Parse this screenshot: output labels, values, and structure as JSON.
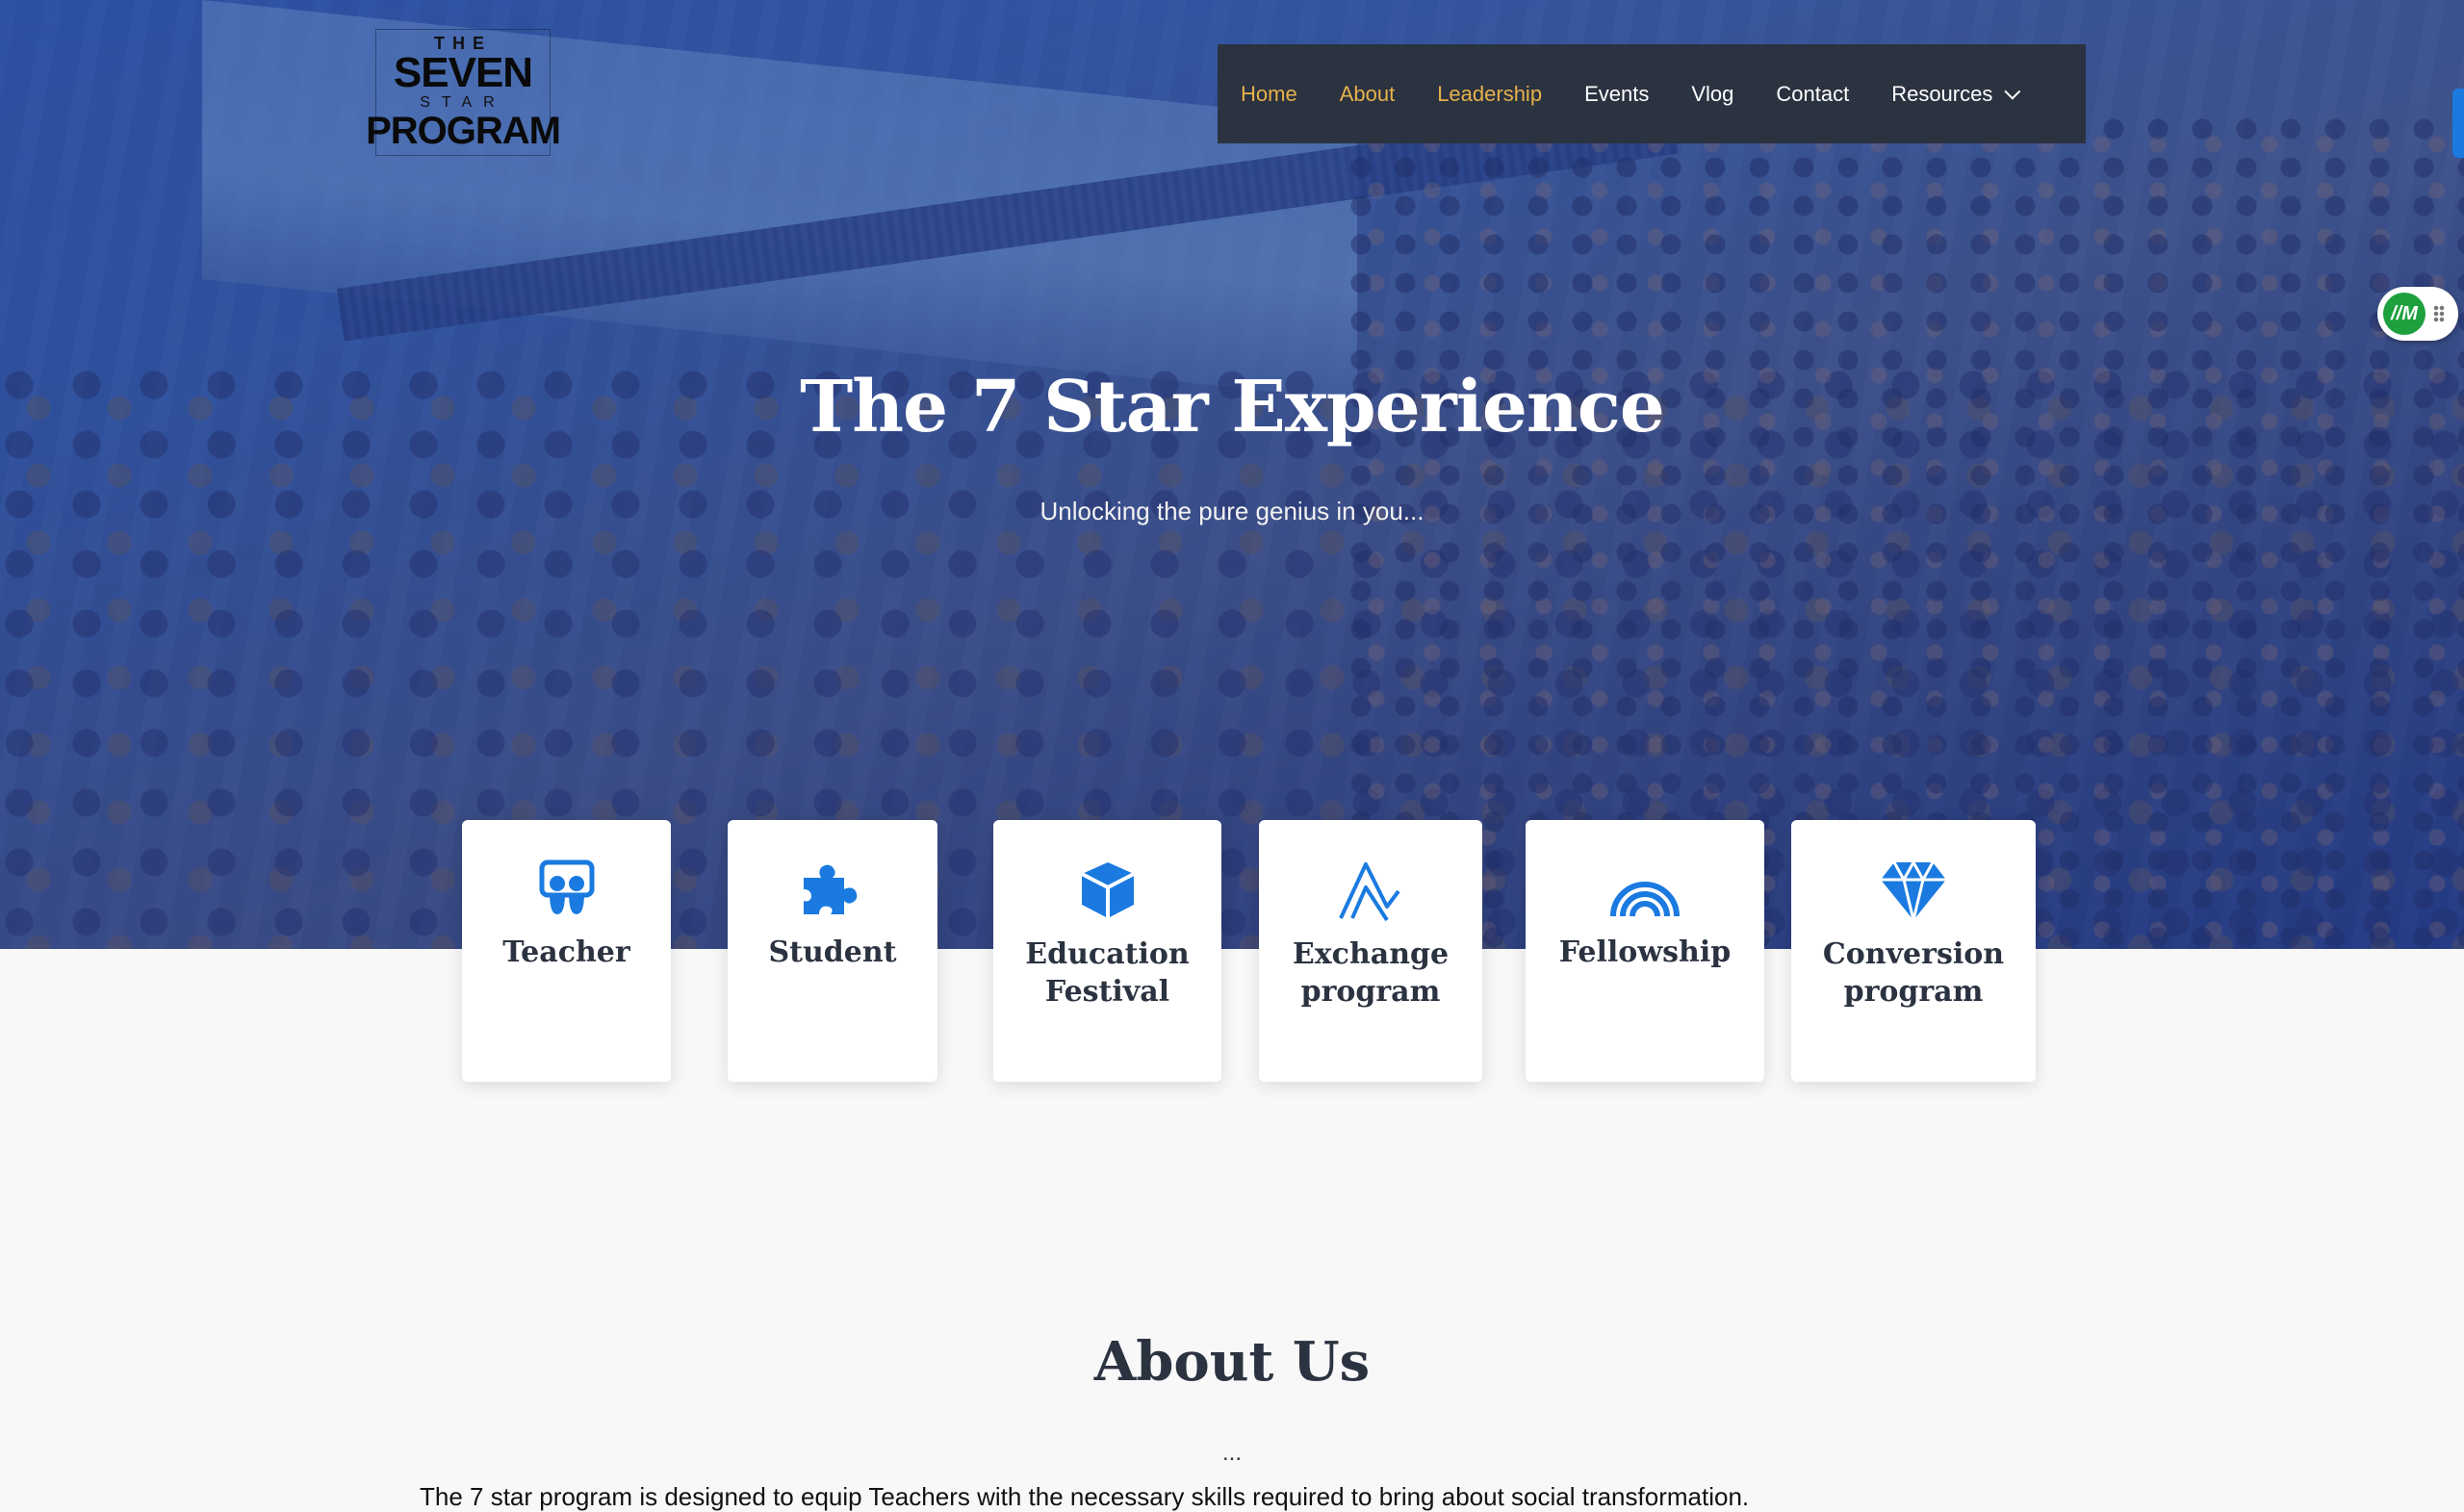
{
  "logo": {
    "line1": "THE",
    "line2": "SEVEN",
    "line3": "STAR",
    "line4": "PROGRAM"
  },
  "nav": {
    "items": [
      {
        "label": "Home",
        "active": true
      },
      {
        "label": "About",
        "active": true
      },
      {
        "label": "Leadership",
        "active": true
      },
      {
        "label": "Events",
        "active": false
      },
      {
        "label": "Vlog",
        "active": false
      },
      {
        "label": "Contact",
        "active": false
      },
      {
        "label": "Resources",
        "active": false,
        "icon": "chevron-down-icon"
      }
    ]
  },
  "hero": {
    "title": "The 7 Star Experience",
    "subtitle": "Unlocking the pure genius in you..."
  },
  "widget": {
    "badge": "//M"
  },
  "programs": [
    {
      "label": "Teacher",
      "icon": "slideshare-icon"
    },
    {
      "label": "Student",
      "icon": "puzzle-icon"
    },
    {
      "label": "Education Festival",
      "icon": "cube-icon"
    },
    {
      "label": "Exchange program",
      "icon": "zigzag-icon"
    },
    {
      "label": "Fellowship",
      "icon": "rainbow-icon"
    },
    {
      "label": "Conversion program",
      "icon": "diamond-icon"
    }
  ],
  "about": {
    "title": "About Us",
    "dots": "...",
    "text": "The 7 star program is designed to equip Teachers with the necessary skills required to bring about social transformation."
  },
  "colors": {
    "accent": "#1a7ae0",
    "nav_bg": "#2b3240",
    "nav_active": "#e6b24a",
    "heading": "#2b3240",
    "widget_green": "#1da13f"
  }
}
